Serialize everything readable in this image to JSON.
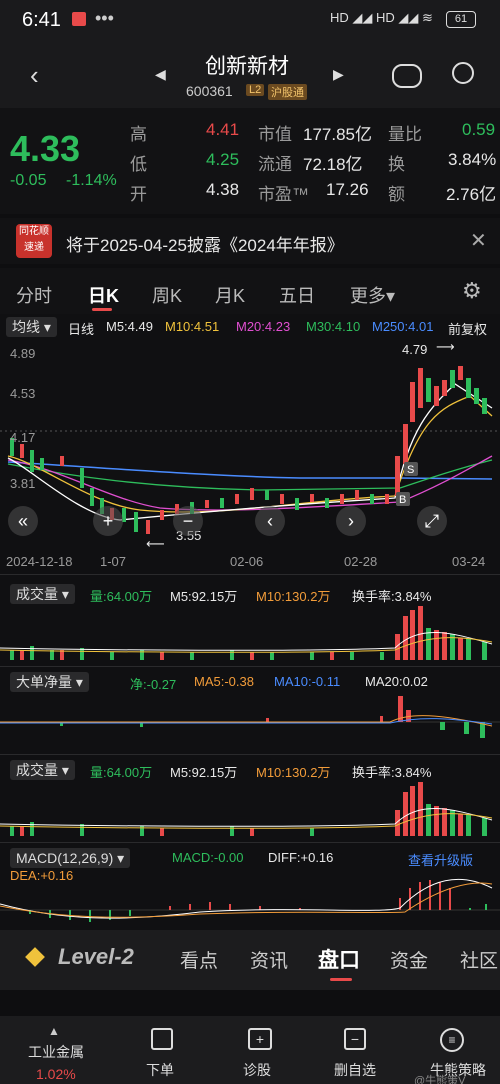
{
  "status_bar": {
    "time": "6:41",
    "icons": "HD ◢◢ HD ◢◢ ≋",
    "battery": "61"
  },
  "header": {
    "name": "创新新材",
    "code": "600361",
    "level_badge": "L2",
    "market_badge": "沪股通"
  },
  "quote": {
    "price": "4.33",
    "change": "-0.05",
    "change_pct": "-1.14%",
    "high_label": "高",
    "high": "4.41",
    "low_label": "低",
    "low": "4.25",
    "open_label": "开",
    "open": "4.38",
    "mcap_label": "市值",
    "mcap": "177.85亿",
    "float_label": "流通",
    "float": "72.18亿",
    "pe_label": "市盈™",
    "pe": "17.26",
    "vr_label": "量比",
    "vr": "0.59",
    "turn_label": "换",
    "turn": "3.84%",
    "amt_label": "额",
    "amt": "2.76亿"
  },
  "notice": {
    "logo_top": "同花顺",
    "logo_bottom": "速递",
    "text": "将于2025-04-25披露《2024年年报》"
  },
  "tabs": [
    "分时",
    "日K",
    "周K",
    "月K",
    "五日",
    "更多▾"
  ],
  "ma_bar": {
    "ma_sel": "均线 ▾",
    "period": "日线",
    "m5": "M5:4.49",
    "m10": "M10:4.51",
    "m20": "M20:4.23",
    "m30": "M30:4.10",
    "m250": "M250:4.01",
    "adjust": "前复权"
  },
  "kline": {
    "y_labels": [
      "4.89",
      "4.53",
      "4.17",
      "3.81"
    ],
    "high_mark": "4.79",
    "low_mark": "3.55",
    "x_labels": [
      "2024-12-18",
      "1-07",
      "02-06",
      "02-28",
      "03-24"
    ],
    "tag_s": "S",
    "tag_b": "B"
  },
  "vol1": {
    "sel": "成交量 ▾",
    "v": "量:64.00万",
    "m5": "M5:92.15万",
    "m10": "M10:130.2万",
    "turn": "换手率:3.84%"
  },
  "bigorder": {
    "sel": "大单净量 ▾",
    "net": "净:-0.27",
    "ma5": "MA5:-0.38",
    "ma10": "MA10:-0.11",
    "ma20": "MA20:0.02"
  },
  "vol2": {
    "sel": "成交量 ▾",
    "v": "量:64.00万",
    "m5": "M5:92.15万",
    "m10": "M10:130.2万",
    "turn": "换手率:3.84%"
  },
  "macd": {
    "sel": "MACD(12,26,9) ▾",
    "macd": "MACD:-0.00",
    "diff": "DIFF:+0.16",
    "dea": "DEA:+0.16",
    "upgrade": "查看升级版"
  },
  "bottom_tabs": [
    "Level-2",
    "看点",
    "资讯",
    "盘口",
    "资金",
    "社区"
  ],
  "bottom_nav": [
    {
      "label": "工业金属",
      "sub": "1.02%"
    },
    {
      "label": "下单"
    },
    {
      "label": "诊股"
    },
    {
      "label": "删自选"
    },
    {
      "label": "牛熊策略"
    }
  ],
  "watermark": "@牛熊策V"
}
